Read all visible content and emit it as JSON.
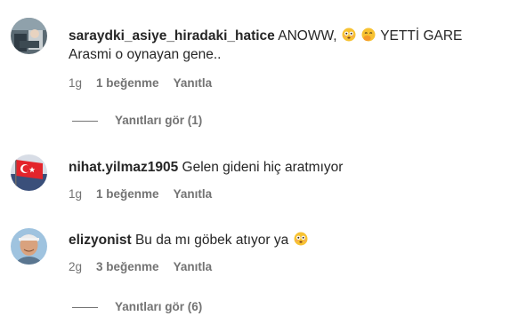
{
  "comments": [
    {
      "username": "saraydki_asiye_hiradaki_hatice",
      "text_part1": "ANOWW,",
      "text_part2": "YETTİ GARE",
      "text_line2": "Arasmi o oynayan gene..",
      "time": "1g",
      "likes": "1 beğenme",
      "reply": "Yanıtla",
      "view_replies": "Yanıtları gör (1)",
      "emojis": [
        "flushed-face-emoji",
        "face-with-hand-over-mouth-emoji"
      ]
    },
    {
      "username": "nihat.yilmaz1905",
      "text": "Gelen gideni hiç aratmıyor",
      "time": "1g",
      "likes": "1 beğenme",
      "reply": "Yanıtla"
    },
    {
      "username": "elizyonist",
      "text": "Bu da mı göbek atıyor ya",
      "time": "2g",
      "likes": "3 beğenme",
      "reply": "Yanıtla",
      "view_replies": "Yanıtları gör (6)",
      "emojis": [
        "flushed-face-emoji"
      ]
    }
  ],
  "colors": {
    "primary_text": "#262626",
    "secondary_text": "#737373",
    "emoji_yellow": "#f7c232"
  }
}
